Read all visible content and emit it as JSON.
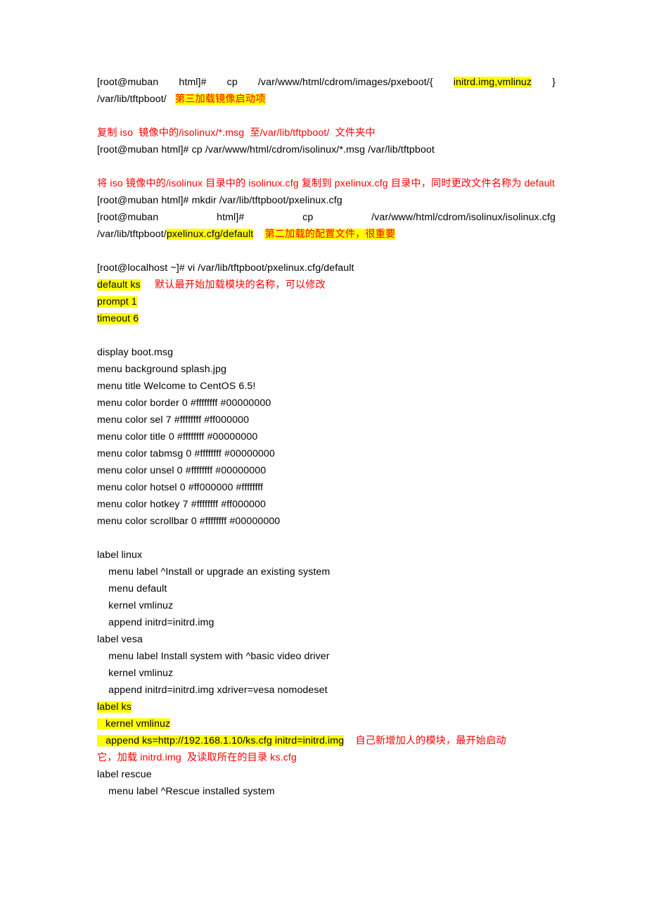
{
  "document": {
    "blocks": [
      {
        "id": "cmd_cp_pxeboot",
        "type": "justified_command",
        "segments": [
          {
            "text": "[root@muban",
            "style": "plain"
          },
          {
            "text": "html]#",
            "style": "plain"
          },
          {
            "text": "cp",
            "style": "plain"
          },
          {
            "text": "/var/www/html/cdrom/images/pxeboot/{",
            "style": "plain"
          },
          {
            "text": "initrd.img,vmlinuz",
            "style": "highlight"
          },
          {
            "text": "}",
            "style": "plain"
          }
        ]
      },
      {
        "id": "cmd_cp_pxeboot_cont",
        "type": "mixed",
        "segments": [
          {
            "text": "/var/lib/tftpboot/   ",
            "style": "plain"
          },
          {
            "text": "第三加载镜像启动项",
            "style": "highlight-red"
          }
        ]
      },
      {
        "id": "blank_1",
        "type": "blank"
      },
      {
        "id": "note_copy_msg",
        "type": "mixed",
        "segments": [
          {
            "text": "复制 iso  镜像中的/isolinux/*.msg  至/var/lib/tftpboot/  文件夹中",
            "style": "red"
          }
        ]
      },
      {
        "id": "cmd_cp_msg",
        "type": "mixed",
        "segments": [
          {
            "text": "[root@muban html]# cp /var/www/html/cdrom/isolinux/*.msg /var/lib/tftpboot",
            "style": "plain"
          }
        ]
      },
      {
        "id": "blank_2",
        "type": "blank"
      },
      {
        "id": "note_copy_cfg",
        "type": "wrap_red",
        "segments": [
          {
            "text": "将 iso  镜像中的/isolinux  目录中的 isolinux.cfg 复制到 pxelinux.cfg 目录中，同时更改文件名称为 default",
            "style": "red"
          }
        ]
      },
      {
        "id": "cmd_mkdir",
        "type": "mixed",
        "segments": [
          {
            "text": "[root@muban html]# mkdir /var/lib/tftpboot/pxelinux.cfg",
            "style": "plain"
          }
        ]
      },
      {
        "id": "cmd_cp_isolinux",
        "type": "justified_command",
        "segments": [
          {
            "text": "[root@muban",
            "style": "plain"
          },
          {
            "text": "html]#",
            "style": "plain"
          },
          {
            "text": "cp",
            "style": "plain"
          },
          {
            "text": "/var/www/html/cdrom/isolinux/isolinux.cfg",
            "style": "plain"
          }
        ]
      },
      {
        "id": "cmd_cp_isolinux_cont",
        "type": "mixed",
        "segments": [
          {
            "text": "/var/lib/tftpboot/",
            "style": "plain"
          },
          {
            "text": "pxelinux.cfg/default",
            "style": "highlight"
          },
          {
            "text": "    ",
            "style": "plain"
          },
          {
            "text": "第二加载的配置文件，很重要",
            "style": "highlight-red"
          }
        ]
      },
      {
        "id": "blank_3",
        "type": "blank"
      },
      {
        "id": "cmd_vi_default",
        "type": "mixed",
        "segments": [
          {
            "text": "[root@localhost ~]# vi /var/lib/tftpboot/pxelinux.cfg/default",
            "style": "plain"
          }
        ]
      },
      {
        "id": "cfg_default_ks",
        "type": "mixed",
        "segments": [
          {
            "text": "default ks",
            "style": "highlight"
          },
          {
            "text": "     ",
            "style": "plain"
          },
          {
            "text": "默认最开始加载模块的名称，可以修改",
            "style": "red"
          }
        ]
      },
      {
        "id": "cfg_prompt",
        "type": "mixed",
        "segments": [
          {
            "text": "prompt 1",
            "style": "highlight"
          }
        ]
      },
      {
        "id": "cfg_timeout",
        "type": "mixed",
        "segments": [
          {
            "text": "timeout 6",
            "style": "highlight"
          }
        ]
      },
      {
        "id": "blank_4",
        "type": "blank"
      },
      {
        "id": "cfg_display",
        "type": "mixed",
        "segments": [
          {
            "text": "display boot.msg",
            "style": "plain"
          }
        ]
      },
      {
        "id": "cfg_background",
        "type": "mixed",
        "segments": [
          {
            "text": "menu background splash.jpg",
            "style": "plain"
          }
        ]
      },
      {
        "id": "cfg_title",
        "type": "mixed",
        "segments": [
          {
            "text": "menu title Welcome to CentOS 6.5!",
            "style": "plain"
          }
        ]
      },
      {
        "id": "cfg_color_border",
        "type": "mixed",
        "segments": [
          {
            "text": "menu color border 0 #ffffffff #00000000",
            "style": "plain"
          }
        ]
      },
      {
        "id": "cfg_color_sel",
        "type": "mixed",
        "segments": [
          {
            "text": "menu color sel 7 #ffffffff #ff000000",
            "style": "plain"
          }
        ]
      },
      {
        "id": "cfg_color_title",
        "type": "mixed",
        "segments": [
          {
            "text": "menu color title 0 #ffffffff #00000000",
            "style": "plain"
          }
        ]
      },
      {
        "id": "cfg_color_tabmsg",
        "type": "mixed",
        "segments": [
          {
            "text": "menu color tabmsg 0 #ffffffff #00000000",
            "style": "plain"
          }
        ]
      },
      {
        "id": "cfg_color_unsel",
        "type": "mixed",
        "segments": [
          {
            "text": "menu color unsel 0 #ffffffff #00000000",
            "style": "plain"
          }
        ]
      },
      {
        "id": "cfg_color_hotsel",
        "type": "mixed",
        "segments": [
          {
            "text": "menu color hotsel 0 #ff000000 #ffffffff",
            "style": "plain"
          }
        ]
      },
      {
        "id": "cfg_color_hotkey",
        "type": "mixed",
        "segments": [
          {
            "text": "menu color hotkey 7 #ffffffff #ff000000",
            "style": "plain"
          }
        ]
      },
      {
        "id": "cfg_color_scrollbar",
        "type": "mixed",
        "segments": [
          {
            "text": "menu color scrollbar 0 #ffffffff #00000000",
            "style": "plain"
          }
        ]
      },
      {
        "id": "blank_5",
        "type": "blank"
      },
      {
        "id": "label_linux",
        "type": "mixed",
        "segments": [
          {
            "text": "label linux",
            "style": "plain"
          }
        ]
      },
      {
        "id": "linux_menu_label",
        "type": "mixed",
        "segments": [
          {
            "text": "    menu label ^Install or upgrade an existing system",
            "style": "plain"
          }
        ]
      },
      {
        "id": "linux_menu_default",
        "type": "mixed",
        "segments": [
          {
            "text": "    menu default",
            "style": "plain"
          }
        ]
      },
      {
        "id": "linux_kernel",
        "type": "mixed",
        "segments": [
          {
            "text": "    kernel vmlinuz",
            "style": "plain"
          }
        ]
      },
      {
        "id": "linux_append",
        "type": "mixed",
        "segments": [
          {
            "text": "    append initrd=initrd.img",
            "style": "plain"
          }
        ]
      },
      {
        "id": "label_vesa",
        "type": "mixed",
        "segments": [
          {
            "text": "label vesa",
            "style": "plain"
          }
        ]
      },
      {
        "id": "vesa_menu_label",
        "type": "mixed",
        "segments": [
          {
            "text": "    menu label Install system with ^basic video driver",
            "style": "plain"
          }
        ]
      },
      {
        "id": "vesa_kernel",
        "type": "mixed",
        "segments": [
          {
            "text": "    kernel vmlinuz",
            "style": "plain"
          }
        ]
      },
      {
        "id": "vesa_append",
        "type": "mixed",
        "segments": [
          {
            "text": "    append initrd=initrd.img xdriver=vesa nomodeset",
            "style": "plain"
          }
        ]
      },
      {
        "id": "label_ks",
        "type": "mixed",
        "segments": [
          {
            "text": "label ks",
            "style": "highlight"
          }
        ]
      },
      {
        "id": "ks_kernel",
        "type": "mixed",
        "segments": [
          {
            "text": "   kernel vmlinuz",
            "style": "highlight"
          }
        ]
      },
      {
        "id": "ks_append",
        "type": "mixed",
        "segments": [
          {
            "text": "   append ks=http://192.168.1.10/ks.cfg initrd=initrd.img",
            "style": "highlight"
          },
          {
            "text": "    ",
            "style": "plain"
          },
          {
            "text": "自己新增加人的模块，最开始启动",
            "style": "red"
          }
        ]
      },
      {
        "id": "ks_note_cont",
        "type": "mixed",
        "segments": [
          {
            "text": "它，加载 initrd.img  及读取所在的目录 ks.cfg",
            "style": "red"
          }
        ]
      },
      {
        "id": "label_rescue",
        "type": "mixed",
        "segments": [
          {
            "text": "label rescue",
            "style": "plain"
          }
        ]
      },
      {
        "id": "rescue_menu_label",
        "type": "mixed",
        "segments": [
          {
            "text": "    menu label ^Rescue installed system",
            "style": "plain"
          }
        ]
      }
    ]
  },
  "colors": {
    "highlight": "#FFFF00",
    "red_text": "#FF0000",
    "body_text": "#000000",
    "page_background": "#FFFFFF"
  }
}
